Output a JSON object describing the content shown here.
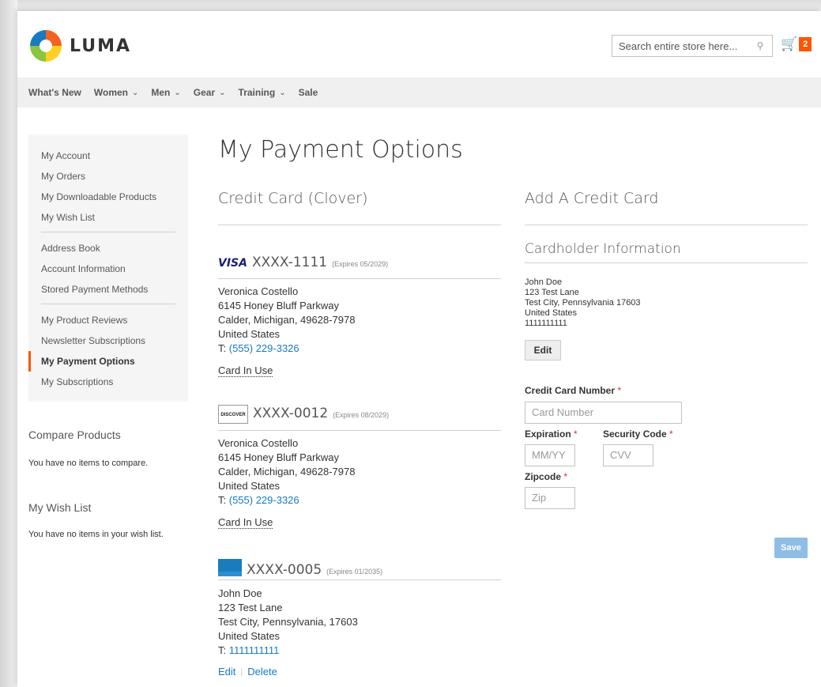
{
  "header": {
    "logo_text": "LUMA",
    "search_placeholder": "Search entire store here...",
    "cart_count": "2"
  },
  "nav": {
    "items": [
      {
        "label": "What's New",
        "has_dropdown": false
      },
      {
        "label": "Women",
        "has_dropdown": true
      },
      {
        "label": "Men",
        "has_dropdown": true
      },
      {
        "label": "Gear",
        "has_dropdown": true
      },
      {
        "label": "Training",
        "has_dropdown": true
      },
      {
        "label": "Sale",
        "has_dropdown": false
      }
    ]
  },
  "account_nav": {
    "group1": [
      "My Account",
      "My Orders",
      "My Downloadable Products",
      "My Wish List"
    ],
    "group2": [
      "Address Book",
      "Account Information",
      "Stored Payment Methods"
    ],
    "group3": [
      "My Product Reviews",
      "Newsletter Subscriptions",
      "My Payment Options",
      "My Subscriptions"
    ],
    "active": "My Payment Options"
  },
  "compare": {
    "title": "Compare Products",
    "empty_text": "You have no items to compare."
  },
  "wishlist": {
    "title": "My Wish List",
    "empty_text": "You have no items in your wish list."
  },
  "main": {
    "page_title": "My Payment Options",
    "left_title": "Credit Card (Clover)",
    "right_title": "Add A Credit Card",
    "cards": [
      {
        "brand": "VISA",
        "number": "XXXX-1111",
        "expiry": "(Expires 05/2029)",
        "name": "Veronica Costello",
        "street": "6145 Honey Bluff Parkway",
        "city": "Calder, Michigan, 49628-7978",
        "country": "United States",
        "phone_prefix": "T: ",
        "phone": "(555) 229-3326",
        "status": "Card In Use"
      },
      {
        "brand": "DISCOVER",
        "number": "XXXX-0012",
        "expiry": "(Expires 08/2029)",
        "name": "Veronica Costello",
        "street": "6145 Honey Bluff Parkway",
        "city": "Calder, Michigan, 49628-7978",
        "country": "United States",
        "phone_prefix": "T: ",
        "phone": "(555) 229-3326",
        "status": "Card In Use"
      },
      {
        "brand": "AMEX",
        "number": "XXXX-0005",
        "expiry": "(Expires 01/2035)",
        "name": "John Doe",
        "street": "123 Test Lane",
        "city": "Test City, Pennsylvania, 17603",
        "country": "United States",
        "phone_prefix": "T: ",
        "phone": "1111111111",
        "edit_label": "Edit",
        "separator": "|",
        "delete_label": "Delete"
      }
    ],
    "cardholder": {
      "title": "Cardholder Information",
      "name": "John Doe",
      "street": "123 Test Lane",
      "city": "Test City, Pennsylvania 17603",
      "country": "United States",
      "phone": "1111111111",
      "edit_label": "Edit"
    },
    "form": {
      "card_number_label": "Credit Card Number",
      "card_number_placeholder": "Card Number",
      "expiration_label": "Expiration",
      "expiration_placeholder": "MM/YY",
      "security_label": "Security Code",
      "security_placeholder": "CVV",
      "zip_label": "Zipcode",
      "zip_placeholder": "Zip",
      "required_mark": "*",
      "save_label": "Save"
    }
  }
}
